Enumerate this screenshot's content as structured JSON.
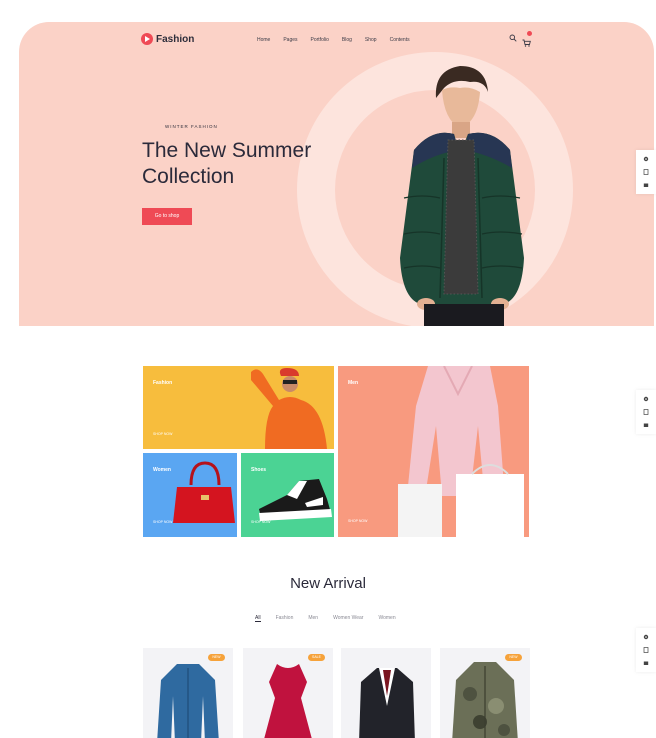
{
  "brand": {
    "name": "Fashion",
    "accent": "#ef4a55"
  },
  "nav": {
    "items": [
      "Home",
      "Pages",
      "Portfolio",
      "Blog",
      "Shop",
      "Contents"
    ],
    "icons": [
      "search-icon",
      "cart-icon"
    ]
  },
  "hero": {
    "kicker": "WINTER FASHION",
    "title_line1": "The New Summer",
    "title_line2": "Collection",
    "cta": "Go to shop",
    "bg": "#fbd2c7"
  },
  "side_tools": {
    "icons": [
      "gear-icon",
      "document-icon",
      "cart-icon"
    ]
  },
  "categories": [
    {
      "label": "Fashion",
      "link": "SHOP NOW",
      "color": "#f7bd3d"
    },
    {
      "label": "Men",
      "link": "SHOP NOW",
      "color": "#f89a7f"
    },
    {
      "label": "Women",
      "link": "SHOP NOW",
      "color": "#5aa6f2"
    },
    {
      "label": "Shoes",
      "link": "SHOP NOW",
      "color": "#4bd394"
    }
  ],
  "new_arrival": {
    "title": "New Arrival",
    "filters": [
      "All",
      "Fashion",
      "Men",
      "Women Wear",
      "Women"
    ],
    "active_filter": "All",
    "products": [
      {
        "badge": "NEW",
        "item": "denim-shirt"
      },
      {
        "badge": "SALE",
        "item": "red-dress"
      },
      {
        "badge": "",
        "item": "suit-jacket"
      },
      {
        "badge": "NEW",
        "item": "camo-jacket"
      }
    ]
  }
}
